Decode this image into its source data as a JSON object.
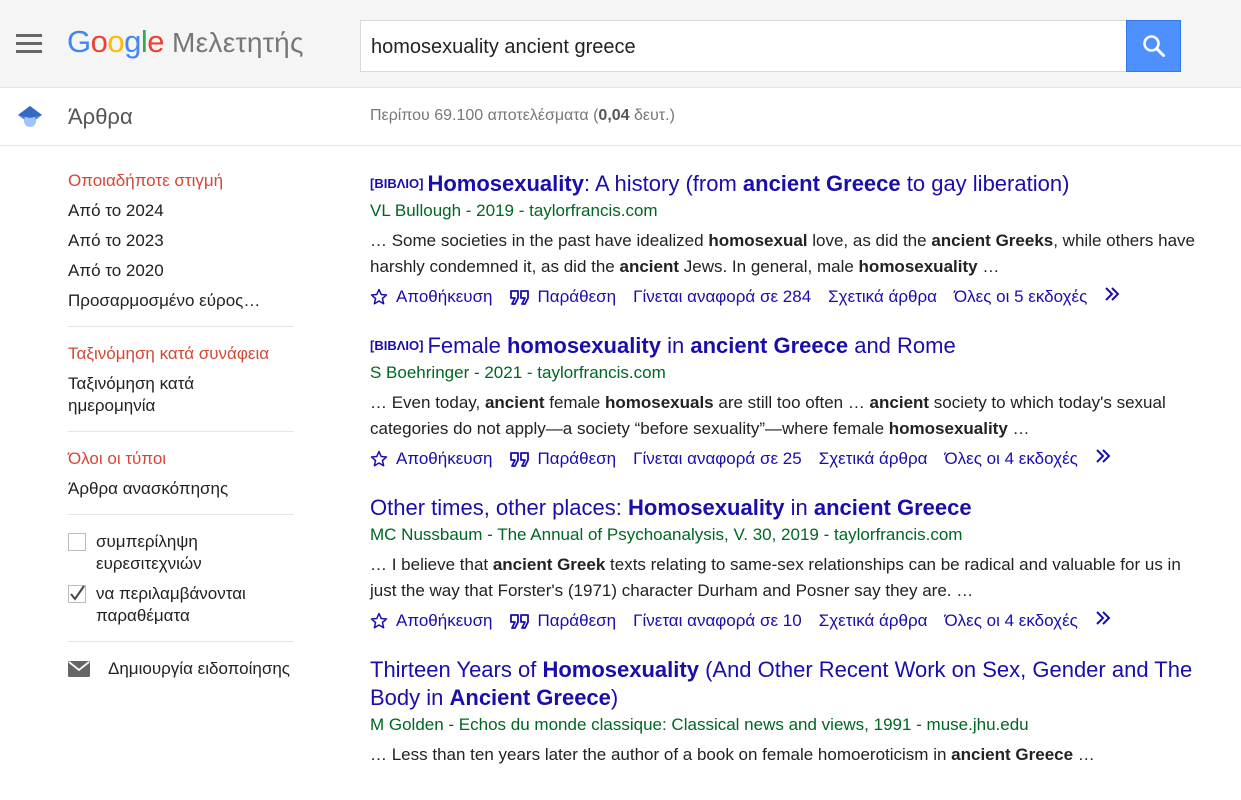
{
  "header": {
    "logo_letters": [
      "G",
      "o",
      "o",
      "g",
      "l",
      "e"
    ],
    "product": "Μελετητής",
    "search_value": "homosexuality ancient greece"
  },
  "subbar": {
    "section": "Άρθρα",
    "results_prefix": "Περίπου 69.100 αποτελέσματα (",
    "results_time": "0,04",
    "results_suffix": " δευτ.)"
  },
  "sidebar": {
    "time_filters": [
      "Οποιαδήποτε στιγμή",
      "Από το 2024",
      "Από το 2023",
      "Από το 2020",
      "Προσαρμοσμένο εύρος…"
    ],
    "sort": [
      "Ταξινόμηση κατά συνάφεια",
      "Ταξινόμηση κατά\n   ημερομηνία"
    ],
    "types": [
      "Όλοι οι τύποι",
      "Άρθρα ανασκόπησης"
    ],
    "include_patents": "συμπερίληψη ευρεσιτεχνιών",
    "include_citations": "να περιλαμβάνονται παραθέματα",
    "create_alert": "Δημιουργία ειδοποίησης"
  },
  "actions": {
    "save": "Αποθήκευση",
    "cite": "Παράθεση",
    "related": "Σχετικά άρθρα"
  },
  "results": [
    {
      "tag": "[ΒΙΒΛΙΟ]",
      "title_parts": [
        [
          "Homosexuality",
          true
        ],
        [
          ": A history (from ",
          false
        ],
        [
          "ancient Greece",
          true
        ],
        [
          " to gay liberation)",
          false
        ]
      ],
      "authors": "VL Bullough",
      "source": " - 2019 - taylorfrancis.com",
      "snippet_parts": [
        [
          "… Some societies in the past have idealized ",
          false
        ],
        [
          "homosexual",
          true
        ],
        [
          " love, as did the ",
          false
        ],
        [
          "ancient Greeks",
          true
        ],
        [
          ", while others have harshly condemned it, as did the ",
          false
        ],
        [
          "ancient",
          true
        ],
        [
          " Jews. In general, male ",
          false
        ],
        [
          "homosexuality",
          true
        ],
        [
          " …",
          false
        ]
      ],
      "cited_by": "Γίνεται αναφορά σε 284",
      "versions": "Όλες οι 5 εκδοχές"
    },
    {
      "tag": "[ΒΙΒΛΙΟ]",
      "title_parts": [
        [
          "Female ",
          false
        ],
        [
          "homosexuality",
          true
        ],
        [
          " in ",
          false
        ],
        [
          "ancient Greece",
          true
        ],
        [
          " and Rome",
          false
        ]
      ],
      "authors": "S Boehringer",
      "source": " - 2021 - taylorfrancis.com",
      "snippet_parts": [
        [
          "… Even today, ",
          false
        ],
        [
          "ancient",
          true
        ],
        [
          " female ",
          false
        ],
        [
          "homosexuals",
          true
        ],
        [
          " are still too often … ",
          false
        ],
        [
          "ancient",
          true
        ],
        [
          " society to which today's sexual categories do not apply—a society “before sexuality”—where female ",
          false
        ],
        [
          "homosexuality",
          true
        ],
        [
          " …",
          false
        ]
      ],
      "cited_by": "Γίνεται αναφορά σε 25",
      "versions": "Όλες οι 4 εκδοχές"
    },
    {
      "tag": "",
      "title_parts": [
        [
          "Other times, other places: ",
          false
        ],
        [
          "Homosexuality",
          true
        ],
        [
          " in ",
          false
        ],
        [
          "ancient Greece",
          true
        ]
      ],
      "authors": "MC Nussbaum",
      "source": " - The Annual of Psychoanalysis, V. 30, 2019 - taylorfrancis.com",
      "snippet_parts": [
        [
          "… I believe that ",
          false
        ],
        [
          "ancient Greek",
          true
        ],
        [
          " texts relating to same-sex relationships can be radical and valuable for us in just the way that Forster's (1971) character Durham and Posner say they are. …",
          false
        ]
      ],
      "cited_by": "Γίνεται αναφορά σε 10",
      "versions": "Όλες οι 4 εκδοχές"
    },
    {
      "tag": "",
      "title_parts": [
        [
          "Thirteen Years of ",
          false
        ],
        [
          "Homosexuality",
          true
        ],
        [
          " (And Other Recent Work on Sex, Gender and The Body in ",
          false
        ],
        [
          "Ancient Greece",
          true
        ],
        [
          ")",
          false
        ]
      ],
      "authors": "M Golden",
      "source": " - Echos du monde classique: Classical news and views, 1991 - muse.jhu.edu",
      "snippet_parts": [
        [
          "… Less than ten years later the author of a book on female homoeroticism in ",
          false
        ],
        [
          "ancient Greece",
          true
        ],
        [
          " …",
          false
        ]
      ],
      "cited_by": "",
      "versions": ""
    }
  ],
  "colors": {
    "link": "#1a0dab",
    "green": "#006621",
    "active": "#d14836",
    "search_button": "#4d90fe"
  },
  "icons": [
    "menu-icon",
    "search-icon",
    "scholar-cap-icon",
    "star-icon",
    "quote-icon",
    "more-icon",
    "mail-icon",
    "check-icon"
  ]
}
